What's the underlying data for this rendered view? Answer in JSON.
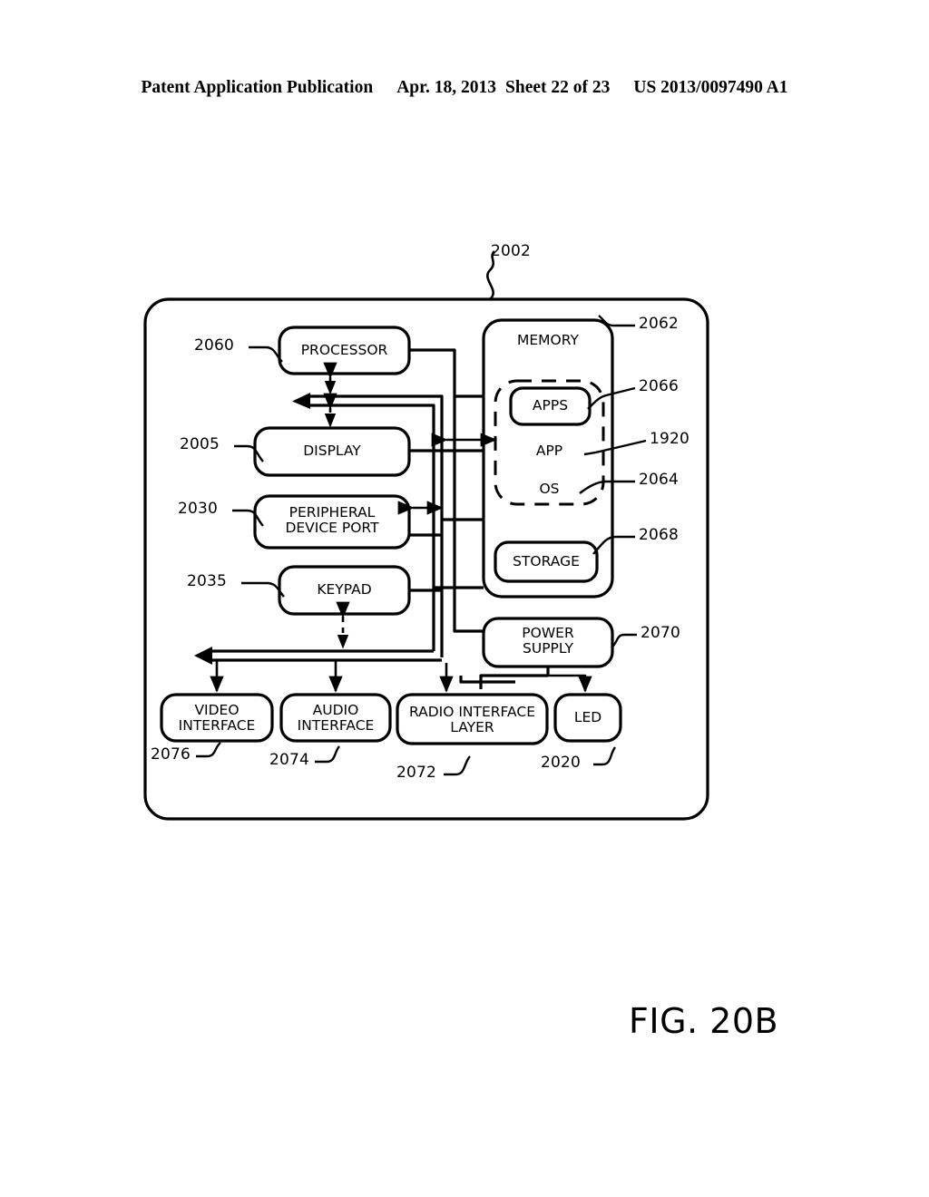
{
  "header": {
    "publication": "Patent Application Publication",
    "date": "Apr. 18, 2013",
    "sheet": "Sheet 22 of 23",
    "docket": "US 2013/0097490 A1"
  },
  "figure": {
    "label": "FIG. 20B",
    "device_ref": "2002"
  },
  "blocks": [
    {
      "id": "processor",
      "label": "PROCESSOR",
      "ref": "2060"
    },
    {
      "id": "display",
      "label": "DISPLAY",
      "ref": "2005"
    },
    {
      "id": "peripheral-port",
      "label": "PERIPHERAL\nDEVICE PORT",
      "ref": "2030"
    },
    {
      "id": "keypad",
      "label": "KEYPAD",
      "ref": "2035"
    },
    {
      "id": "memory",
      "label": "MEMORY",
      "ref": "2062"
    },
    {
      "id": "apps",
      "label": "APPS",
      "ref": "2066"
    },
    {
      "id": "app",
      "label": "APP",
      "ref": "1920"
    },
    {
      "id": "os",
      "label": "OS",
      "ref": "2064"
    },
    {
      "id": "storage",
      "label": "STORAGE",
      "ref": "2068"
    },
    {
      "id": "power-supply",
      "label": "POWER\nSUPPLY",
      "ref": "2070"
    },
    {
      "id": "video-interface",
      "label": "VIDEO\nINTERFACE",
      "ref": "2076"
    },
    {
      "id": "audio-interface",
      "label": "AUDIO\nINTERFACE",
      "ref": "2074"
    },
    {
      "id": "radio-interface",
      "label": "RADIO INTERFACE\nLAYER",
      "ref": "2072"
    },
    {
      "id": "led",
      "label": "LED",
      "ref": "2020"
    }
  ],
  "colors": {
    "ink": "#000000",
    "paper": "#ffffff"
  }
}
